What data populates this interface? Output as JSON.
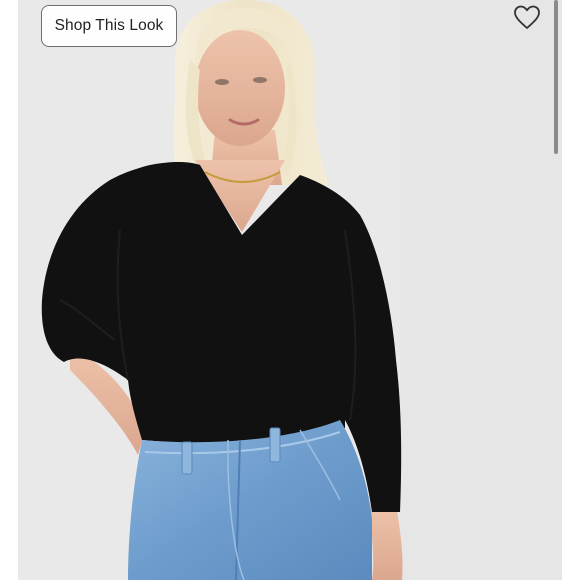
{
  "shop_button": {
    "label": "Shop This Look"
  },
  "favorite": {
    "icon": "heart-outline-icon"
  },
  "photo": {
    "subject": "model-photo",
    "colors": {
      "background": "#e8e8e8",
      "sweater": "#111111",
      "hair": "#efe6cc",
      "skin": "#e6b79e",
      "denim": "#6d9ccc"
    }
  }
}
